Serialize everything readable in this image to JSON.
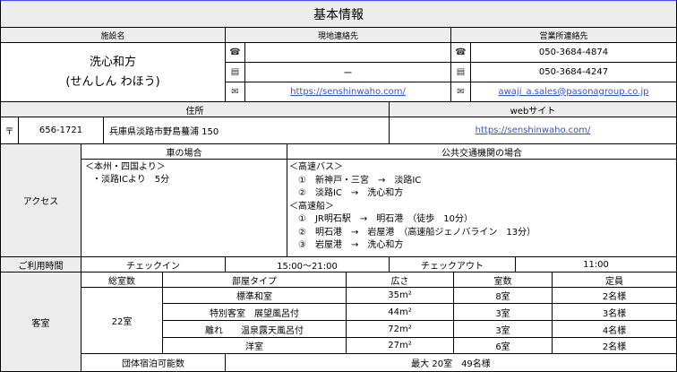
{
  "header": {
    "title": "基本情報"
  },
  "facility": {
    "col_name": "施設名",
    "col_local": "現地連絡先",
    "col_sales": "営業所連絡先",
    "name": "洗心和方",
    "reading": "(せんしん わほう)",
    "local_tel": "",
    "local_fax": "ー",
    "local_url": "https://senshinwaho.com/",
    "sales_tel": "050-3684-4874",
    "sales_fax": "050-3684-4247",
    "sales_email": "awaji_a.sales@pasonagroup.co.jp"
  },
  "address": {
    "label": "住所",
    "postal_symbol": "〒",
    "zip": "656-1721",
    "text": "兵庫県淡路市野島蟇浦 150",
    "web_label": "webサイト",
    "web_url": "https://senshinwaho.com/"
  },
  "access": {
    "label": "アクセス",
    "car_header": "車の場合",
    "public_header": "公共交通機関の場合",
    "car_lines": [
      "＜本州・四国より＞",
      "・淡路ICより　5分"
    ],
    "public_lines": [
      "＜高速バス＞",
      "①　新神戸・三宮　→　淡路IC",
      "②　淡路IC　→　洗心和方",
      "＜高速船＞",
      "①　JR明石駅　→　明石港　（徒歩　10分）",
      "②　明石港　→　岩屋港　（高速船ジェノバライン　13分）",
      "③　岩屋港　→　洗心和方"
    ]
  },
  "hours": {
    "label": "ご利用時間",
    "checkin_label": "チェックイン",
    "checkin_value": "15:00～21:00",
    "checkout_label": "チェックアウト",
    "checkout_value": "11:00"
  },
  "rooms": {
    "label": "客室",
    "total_label": "総室数",
    "total_value": "22室",
    "headers": {
      "type": "部屋タイプ",
      "area": "広さ",
      "count": "室数",
      "capacity": "定員"
    },
    "rows": [
      {
        "type": "標準和室",
        "area": "35m²",
        "count": "8室",
        "capacity": "2名様"
      },
      {
        "type": "特別客室　展望風呂付",
        "area": "44m²",
        "count": "3室",
        "capacity": "3名様"
      },
      {
        "type": "離れ　　温泉露天風呂付",
        "area": "72m²",
        "count": "3室",
        "capacity": "4名様"
      },
      {
        "type": "洋室",
        "area": "27m²",
        "count": "6室",
        "capacity": "2名様"
      }
    ],
    "group_label": "団体宿泊可能数",
    "group_value": "最大 20室　49名様"
  },
  "icons": {
    "phone": "phone-icon",
    "fax": "fax-icon",
    "mail": "mail-icon"
  }
}
